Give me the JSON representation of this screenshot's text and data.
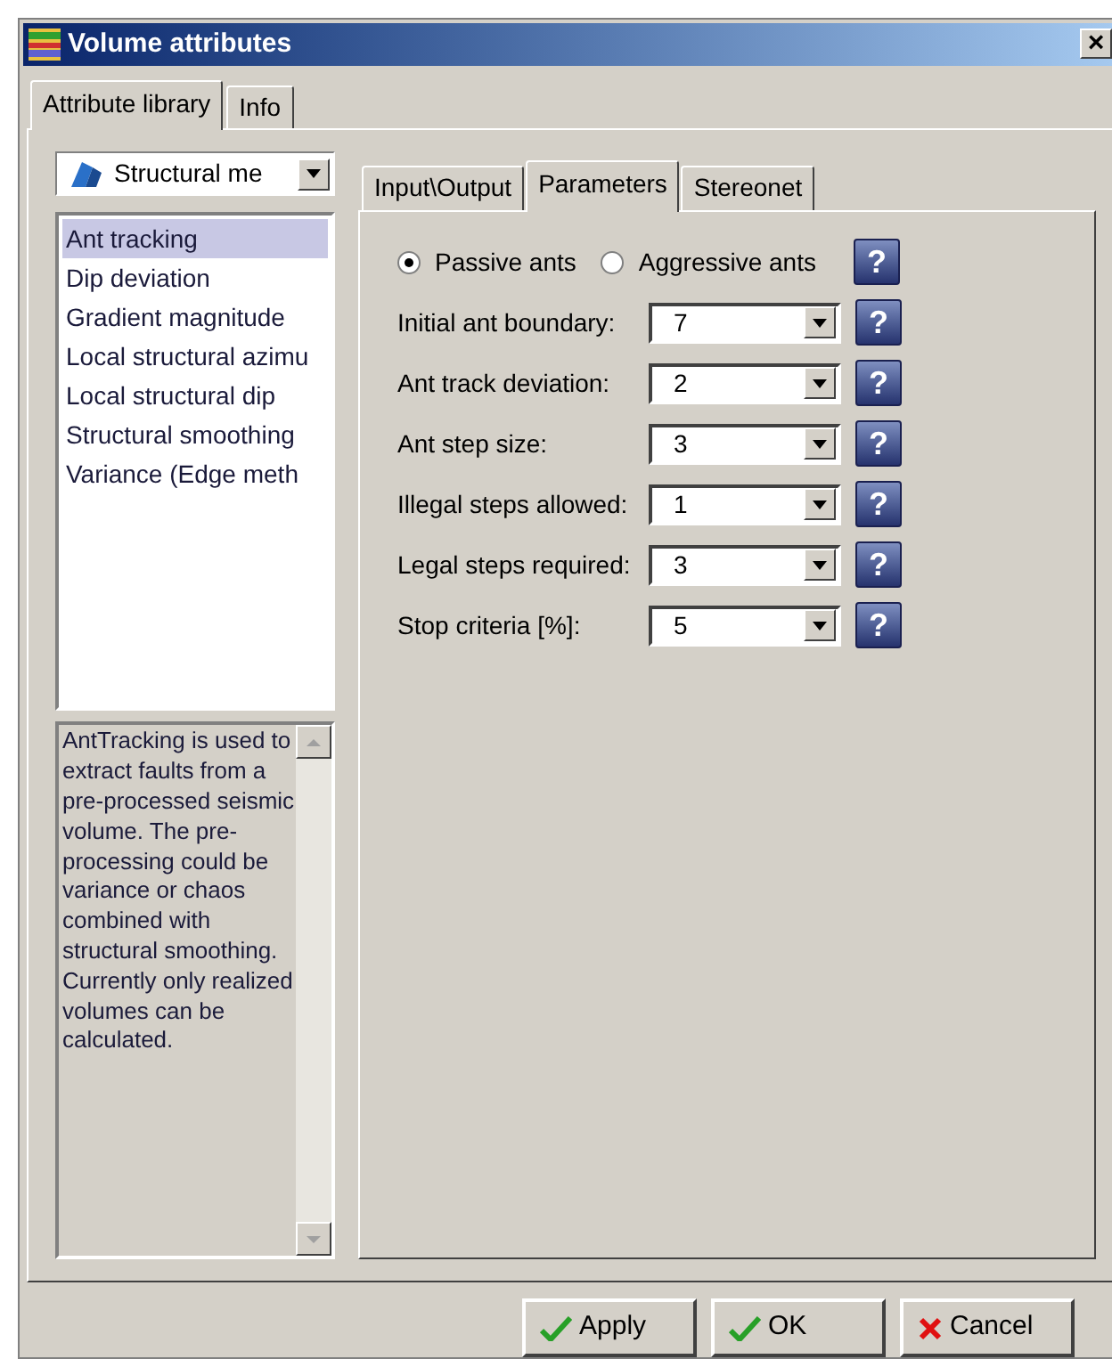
{
  "window": {
    "title": "Volume attributes",
    "close": "×"
  },
  "tabs": [
    {
      "label": "Attribute library",
      "selected": true
    },
    {
      "label": "Info",
      "selected": false
    }
  ],
  "category": {
    "value": "Structural me"
  },
  "attributes": [
    {
      "label": "Ant tracking",
      "selected": true
    },
    {
      "label": "Dip deviation",
      "selected": false
    },
    {
      "label": "Gradient magnitude",
      "selected": false
    },
    {
      "label": "Local structural azimu",
      "selected": false
    },
    {
      "label": "Local structural dip",
      "selected": false
    },
    {
      "label": "Structural smoothing",
      "selected": false
    },
    {
      "label": "Variance (Edge meth",
      "selected": false
    }
  ],
  "description": "AntTracking is used to extract faults from a pre-processed seismic volume. The pre-processing could be variance or chaos combined with structural smoothing. Currently only realized volumes can be calculated.",
  "inner_tabs": [
    {
      "label": "Input\\Output",
      "selected": false
    },
    {
      "label": "Parameters",
      "selected": true
    },
    {
      "label": "Stereonet",
      "selected": false
    }
  ],
  "mode": {
    "options": [
      {
        "label": "Passive ants",
        "selected": true
      },
      {
        "label": "Aggressive ants",
        "selected": false
      }
    ],
    "help": "?"
  },
  "parameters": [
    {
      "label": "Initial ant boundary:",
      "value": "7",
      "help": "?"
    },
    {
      "label": "Ant track deviation:",
      "value": "2",
      "help": "?"
    },
    {
      "label": "Ant step size:",
      "value": "3",
      "help": "?"
    },
    {
      "label": "Illegal steps allowed:",
      "value": "1",
      "help": "?"
    },
    {
      "label": "Legal steps required:",
      "value": "3",
      "help": "?"
    },
    {
      "label": "Stop criteria [%]:",
      "value": "5",
      "help": "?"
    }
  ],
  "buttons": [
    {
      "label": "Apply",
      "kind": "confirm"
    },
    {
      "label": "OK",
      "kind": "confirm"
    },
    {
      "label": "Cancel",
      "kind": "cancel"
    }
  ]
}
